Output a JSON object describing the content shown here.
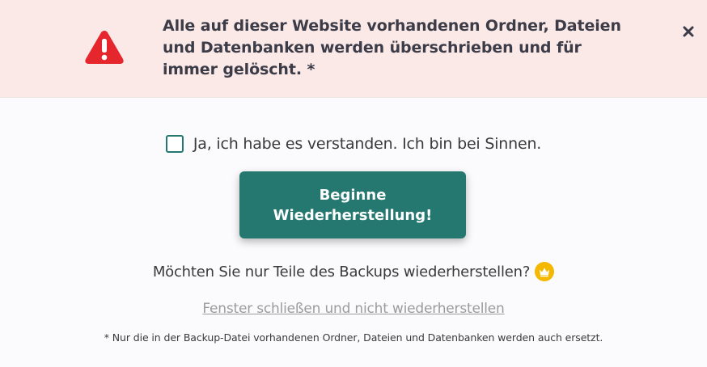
{
  "warning": {
    "text_lines": [
      "Alle auf dieser Website vorhandenen Ordner, Dateien",
      "und Datenbanken werden überschrieben und für",
      "immer gelöscht. *"
    ],
    "icon": "warning-triangle-icon",
    "close_icon": "close-icon",
    "background_color": "#fbe9e7",
    "icon_color": "#e5262d"
  },
  "confirm": {
    "label": "Ja, ich habe es verstanden. Ich bin bei Sinnen.",
    "checked": false
  },
  "restore_button": {
    "label_lines": [
      "Beginne",
      "Wiederherstellung!"
    ],
    "color": "#24786f"
  },
  "partial_restore": {
    "label": "Möchten Sie nur Teile des Backups wiederherstellen?",
    "icon": "crown-icon",
    "icon_color": "#f5b800"
  },
  "close_link": {
    "label": "Fenster schließen und nicht wiederherstellen"
  },
  "footnote": {
    "text": "* Nur die in der Backup-Datei vorhandenen Ordner, Dateien und Datenbanken werden auch ersetzt."
  }
}
